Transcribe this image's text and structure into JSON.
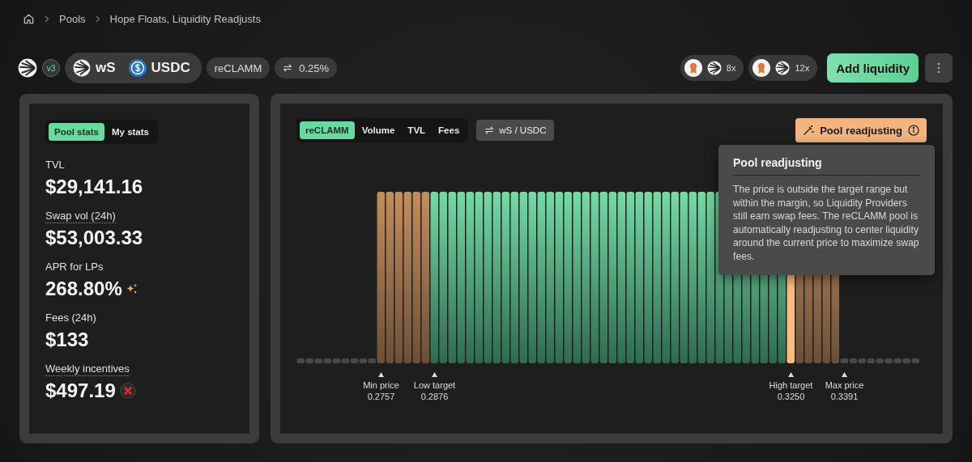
{
  "breadcrumb": {
    "items": [
      "Pools",
      "Hope Floats, Liquidity Readjusts"
    ]
  },
  "header": {
    "version": "v3",
    "tokens": [
      {
        "symbol": "wS",
        "kind": "sonic"
      },
      {
        "symbol": "USDC",
        "kind": "usdc"
      }
    ],
    "pool_type": "reCLAMM",
    "fee": "0.25%",
    "boosts": [
      {
        "multiplier": "8x"
      },
      {
        "multiplier": "12x"
      }
    ],
    "add_button": "Add liquidity"
  },
  "stats_tabs": [
    {
      "label": "Pool stats",
      "selected": true
    },
    {
      "label": "My stats",
      "selected": false
    }
  ],
  "stats": [
    {
      "label": "TVL",
      "value": "$29,141.16",
      "kind": "plain",
      "underlined": false
    },
    {
      "label": "Swap vol (24h)",
      "value": "$53,003.33",
      "kind": "plain",
      "underlined": true
    },
    {
      "label": "APR for LPs",
      "value": "268.80%",
      "kind": "apr",
      "underlined": false
    },
    {
      "label": "Fees (24h)",
      "value": "$133",
      "kind": "plain",
      "underlined": false
    },
    {
      "label": "Weekly incentives",
      "value": "$497.19",
      "kind": "incentives",
      "underlined": true
    }
  ],
  "chart_tabs": [
    {
      "label": "reCLAMM",
      "selected": true
    },
    {
      "label": "Volume",
      "selected": false
    },
    {
      "label": "TVL",
      "selected": false
    },
    {
      "label": "Fees",
      "selected": false
    }
  ],
  "pair_toggle": "wS / USDC",
  "status": {
    "label": "Pool readjusting"
  },
  "tooltip": {
    "title": "Pool readjusting",
    "text": "The price is outside the target range but within the margin, so Liquidity Providers still earn swap fees. The reCLAMM pool is automatically readjusting to center liquidity around the current price to maximize swap fees."
  },
  "markers": [
    {
      "label": "Min price",
      "value": "0.2757"
    },
    {
      "label": "Low target",
      "value": "0.2876"
    },
    {
      "label": "High target",
      "value": "0.3250"
    },
    {
      "label": "Max price",
      "value": "0.3391"
    }
  ]
}
